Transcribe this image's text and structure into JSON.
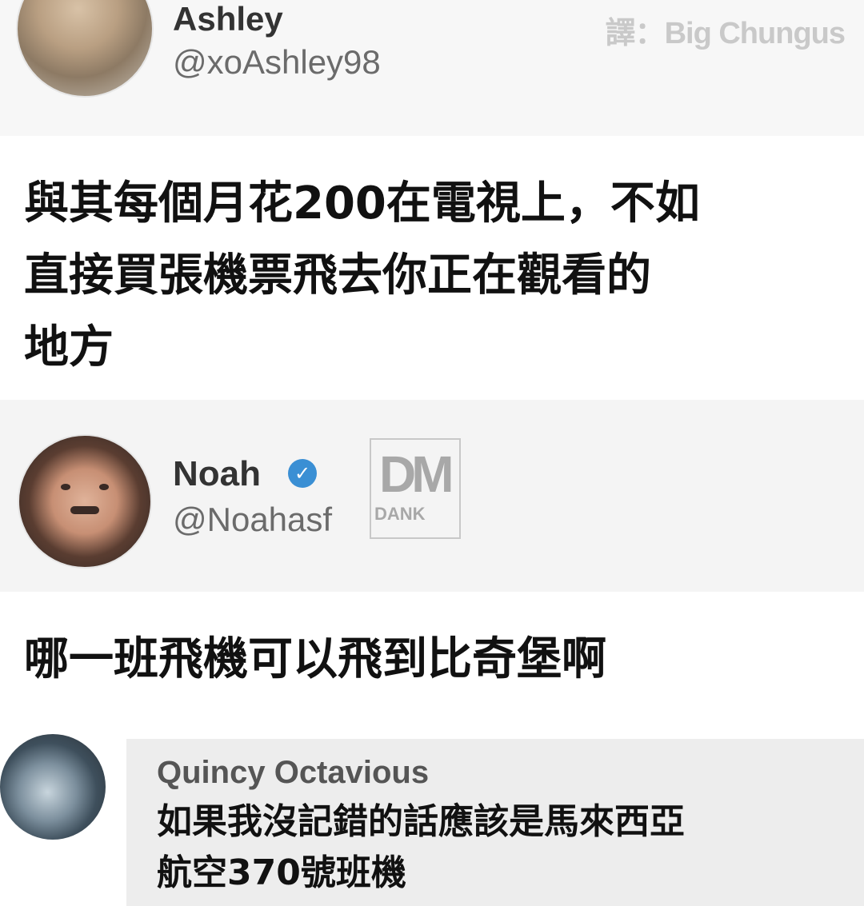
{
  "watermark": "譯：Big Chungus",
  "tweet1": {
    "name": "Ashley",
    "handle": "@xoAshley98",
    "text_lines": [
      "與其每個月花200在電視上，不如",
      "直接買張機票飛去你正在觀看的",
      "地方"
    ]
  },
  "tweet2": {
    "name": "Noah",
    "handle": "@Noahasf",
    "logo_text": "DM",
    "logo_sub": "DANK",
    "text": "哪一班飛機可以飛到比奇堡啊"
  },
  "comment": {
    "name": "Quincy Octavious",
    "text_lines": [
      "如果我沒記錯的話應該是馬來西亞",
      "航空370號班機"
    ]
  }
}
